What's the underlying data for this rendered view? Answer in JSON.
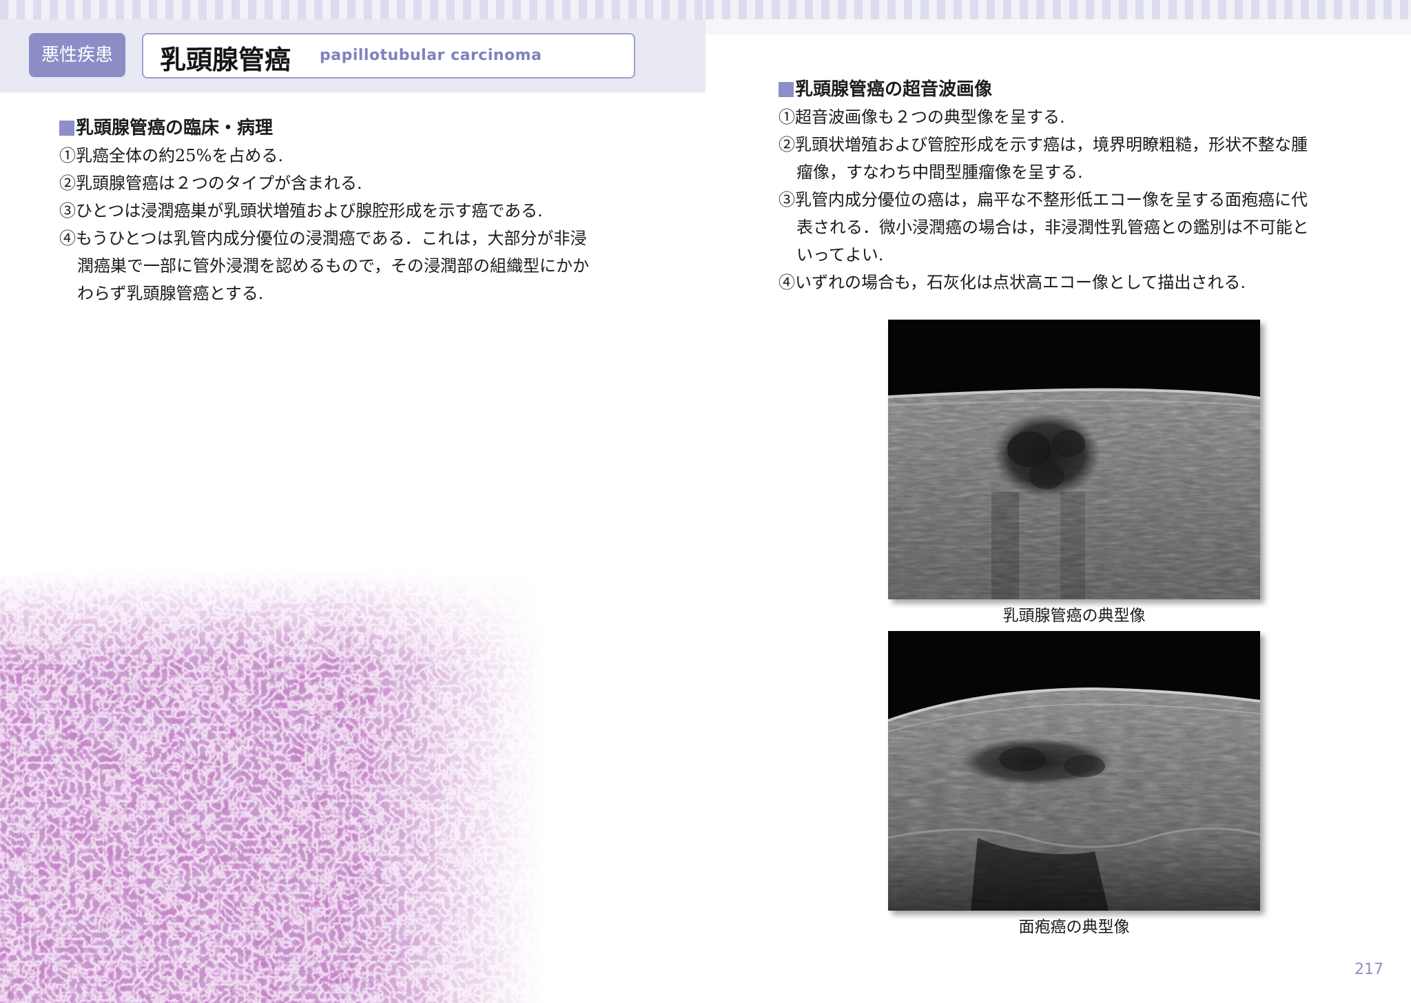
{
  "left_page": {
    "category_badge": "悪性疾患",
    "title_jp": "乳頭腺管癌",
    "title_en": "papillotubular carcinoma",
    "section": {
      "heading": "乳頭腺管癌の臨床・病理",
      "lines": [
        "①乳癌全体の約25%を占める.",
        "②乳頭腺管癌は２つのタイプが含まれる.",
        "③ひとつは浸潤癌巣が乳頭状増殖および腺腔形成を示す癌である.",
        "④もうひとつは乳管内成分優位の浸潤癌である．これは，大部分が非浸",
        "潤癌巣で一部に管外浸潤を認めるもので，その浸潤部の組織型にかか",
        "わらず乳頭腺管癌とする."
      ]
    }
  },
  "right_page": {
    "section": {
      "heading": "乳頭腺管癌の超音波画像",
      "lines": [
        "①超音波画像も２つの典型像を呈する.",
        "②乳頭状増殖および管腔形成を示す癌は，境界明瞭粗糙，形状不整な腫",
        "瘤像，すなわち中間型腫瘤像を呈する.",
        "③乳管内成分優位の癌は，扁平な不整形低エコー像を呈する面疱癌に代",
        "表される．微小浸潤癌の場合は，非浸潤性乳管癌との鑑別は不可能と",
        "いってよい.",
        "④いずれの場合も，石灰化は点状高エコー像として描出される."
      ]
    },
    "figures": [
      {
        "caption": "乳頭腺管癌の典型像"
      },
      {
        "caption": "面疱癌の典型像"
      }
    ],
    "page_number": "217"
  },
  "colors": {
    "accent": "#8b8dc6",
    "accent_light": "#e9e9f4",
    "page_number": "#8e90c4"
  }
}
